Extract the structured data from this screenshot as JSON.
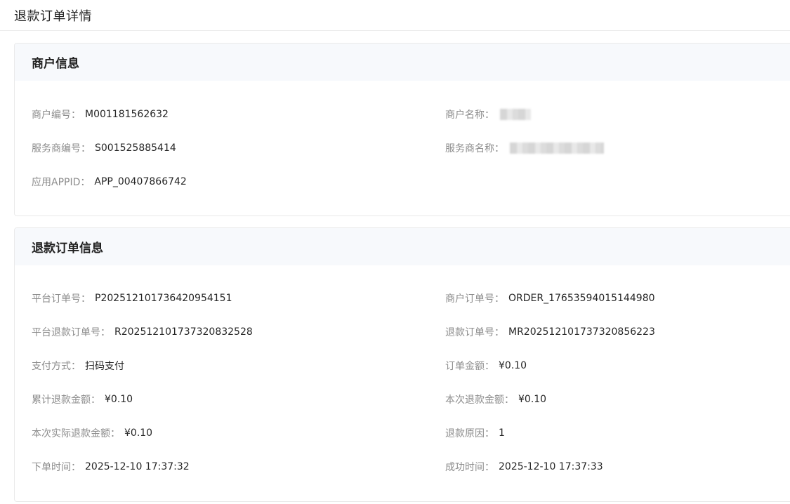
{
  "page": {
    "title": "退款订单详情"
  },
  "merchant_section": {
    "title": "商户信息",
    "merchant_no": {
      "label": "商户编号：",
      "value": "M001181562632"
    },
    "merchant_name": {
      "label": "商户名称："
    },
    "service_provider_no": {
      "label": "服务商编号：",
      "value": "S001525885414"
    },
    "service_provider_name": {
      "label": "服务商名称："
    },
    "app_id": {
      "label": "应用APPID：",
      "value": "APP_00407866742"
    }
  },
  "order_section": {
    "title": "退款订单信息",
    "platform_order_no": {
      "label": "平台订单号：",
      "value": "P202512101736420954151"
    },
    "merchant_order_no": {
      "label": "商户订单号：",
      "value": "ORDER_17653594015144980"
    },
    "platform_refund_no": {
      "label": "平台退款订单号：",
      "value": "R202512101737320832528"
    },
    "refund_order_no": {
      "label": "退款订单号：",
      "value": "MR202512101737320856223"
    },
    "pay_method": {
      "label": "支付方式：",
      "value": "扫码支付"
    },
    "order_amount": {
      "label": "订单金额：",
      "value": "¥0.10"
    },
    "total_refund": {
      "label": "累计退款金额：",
      "value": "¥0.10"
    },
    "this_refund": {
      "label": "本次退款金额：",
      "value": "¥0.10"
    },
    "actual_refund": {
      "label": "本次实际退款金额：",
      "value": "¥0.10"
    },
    "refund_reason": {
      "label": "退款原因：",
      "value": "1"
    },
    "order_time": {
      "label": "下单时间：",
      "value": "2025-12-10 17:37:32"
    },
    "success_time": {
      "label": "成功时间：",
      "value": "2025-12-10 17:37:33"
    }
  }
}
